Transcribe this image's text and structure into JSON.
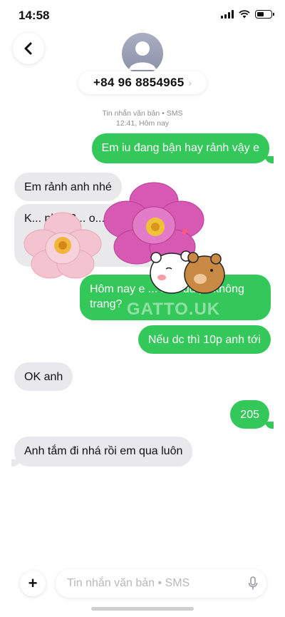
{
  "status": {
    "time": "14:58"
  },
  "header": {
    "contact_number": "+84 96 8854965",
    "chevron": "›"
  },
  "meta": {
    "type": "Tin nhắn văn bản • SMS",
    "time": "12:41, Hôm nay"
  },
  "messages": [
    {
      "direction": "out",
      "text": "Em iu đang bận hay rảnh vậy e"
    },
    {
      "direction": "in",
      "text": "Em rảnh anh nhé"
    },
    {
      "direction": "in",
      "text": "K... nh... 2... o..."
    },
    {
      "direction": "out",
      "text": "Hôm nay e ... nha được không trang?"
    },
    {
      "direction": "out",
      "text": "Nếu dc thì 10p anh tới"
    },
    {
      "direction": "in",
      "text": "OK anh"
    },
    {
      "direction": "out",
      "text": "205"
    },
    {
      "direction": "in",
      "text": "Anh tắm đi nhá rồi em qua luôn"
    }
  ],
  "watermark": "GATTO.UK",
  "composer": {
    "placeholder": "Tin nhắn văn bản • SMS",
    "plus_label": "+"
  },
  "icons": {
    "back": "chevron-left-icon",
    "avatar": "person-icon",
    "mic": "microphone-icon",
    "wifi": "wifi-icon",
    "signal": "cellular-signal-icon",
    "battery": "battery-icon"
  },
  "colors": {
    "outgoing_bubble": "#34c759",
    "incoming_bubble": "#e9e9eb",
    "meta_text": "#8e8e93"
  }
}
